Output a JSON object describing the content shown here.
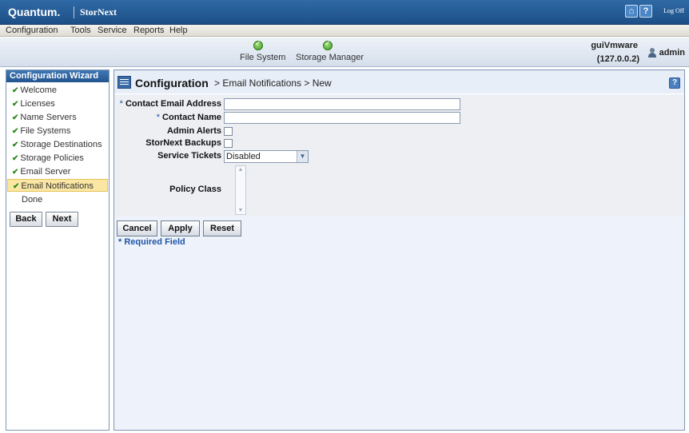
{
  "titlebar": {
    "brand": "Quantum.",
    "product": "StorNext",
    "home_icon": "home-icon",
    "help_icon": "help-icon",
    "logoff_label": "Log Off"
  },
  "menu": {
    "items": [
      "Configuration",
      "Tools",
      "Service",
      "Reports",
      "Help"
    ]
  },
  "status": {
    "items": [
      {
        "label": "File System",
        "state": "ok"
      },
      {
        "label": "Storage Manager",
        "state": "ok"
      }
    ],
    "server_name": "guiVmware",
    "server_ip": "(127.0.0.2)",
    "user": "admin"
  },
  "sidebar": {
    "title": "Configuration Wizard",
    "items": [
      {
        "label": "Welcome",
        "done": true
      },
      {
        "label": "Licenses",
        "done": true
      },
      {
        "label": "Name Servers",
        "done": true
      },
      {
        "label": "File Systems",
        "done": true
      },
      {
        "label": "Storage Destinations",
        "done": true
      },
      {
        "label": "Storage Policies",
        "done": true
      },
      {
        "label": "Email Server",
        "done": true
      },
      {
        "label": "Email Notifications",
        "done": true,
        "active": true
      },
      {
        "label": "Done",
        "done": false
      }
    ],
    "back_label": "Back",
    "next_label": "Next",
    "check_glyph": "✔"
  },
  "main": {
    "title": "Configuration",
    "breadcrumb_rest": "> Email Notifications > New",
    "help_glyph": "?",
    "form": {
      "required_marker": "*",
      "contact_email_label": "Contact Email Address",
      "contact_email_value": "",
      "contact_name_label": "Contact Name",
      "contact_name_value": "",
      "admin_alerts_label": "Admin Alerts",
      "admin_alerts_checked": false,
      "stornext_backups_label": "StorNext Backups",
      "stornext_backups_checked": false,
      "service_tickets_label": "Service Tickets",
      "service_tickets_value": "Disabled",
      "policy_class_label": "Policy Class"
    },
    "buttons": {
      "cancel": "Cancel",
      "apply": "Apply",
      "reset": "Reset"
    },
    "required_note": "* Required Field"
  },
  "colors": {
    "title_bar": "#1d4f86",
    "accent_blue": "#1f55a8",
    "active_item": "#fbe7a3",
    "status_ok": "#3a9a22"
  }
}
